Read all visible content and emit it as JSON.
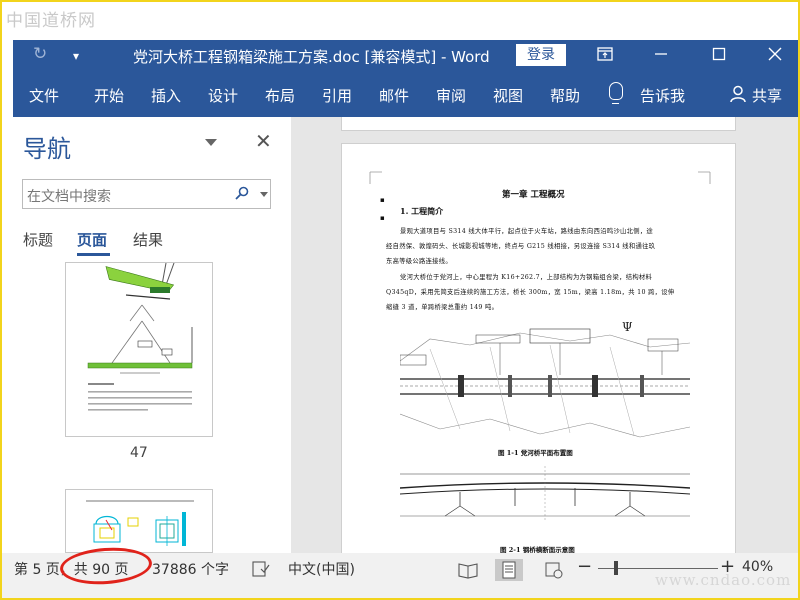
{
  "watermark": {
    "top": "中国道桥网",
    "bottom": "www.cndao.com"
  },
  "titlebar": {
    "title": "党河大桥工程钢箱梁施工方案.doc [兼容模式]  -  Word",
    "login_label": "登录"
  },
  "ribbon": {
    "tabs": [
      "文件",
      "开始",
      "插入",
      "设计",
      "布局",
      "引用",
      "邮件",
      "审阅",
      "视图",
      "帮助"
    ],
    "tell_me": "告诉我",
    "share": "共享"
  },
  "nav": {
    "title": "导航",
    "search_placeholder": "在文档中搜索",
    "tabs": [
      "标题",
      "页面",
      "结果"
    ],
    "active_tab": "页面",
    "thumbnail_page": "47"
  },
  "document": {
    "chapter_title": "第一章    工程概况",
    "section_title": "1. 工程简介",
    "para1": [
      "景观大道项目与 S314 线大体平行，起点位于火车站，路线由东向西沿鸣沙山北侧，途",
      "经自然保、敦煌码头、长城影视城等地，终点与 G215 线相接，另设连接 S314 线和通往玖",
      "东高等级公路连接线。"
    ],
    "para2": [
      "党河大桥位于党河上，中心里程为 K16+262.7，上部结构为为钢箱组合梁，结构材料",
      "Q345qD，采用先简支后连续的施工方法，桥长 300m，宽 15m，梁高 1.18m，共 10 跨，设伸",
      "缩缝 3 道，单跨桥梁总重约 149 吨。"
    ],
    "figure1_caption": "图 1-1  党河桥平面布置图",
    "figure2_caption": "图 2-1  钢桥横断面示意图"
  },
  "status": {
    "page_info": "第 5 页，共 90 页",
    "word_count": "37886 个字",
    "language": "中文(中国)",
    "zoom_minus": "−",
    "zoom_plus": "+",
    "zoom_level": "40%"
  },
  "colors": {
    "accent": "#2b579a",
    "annotation": "#e0231b",
    "frame": "#f2d41c"
  }
}
